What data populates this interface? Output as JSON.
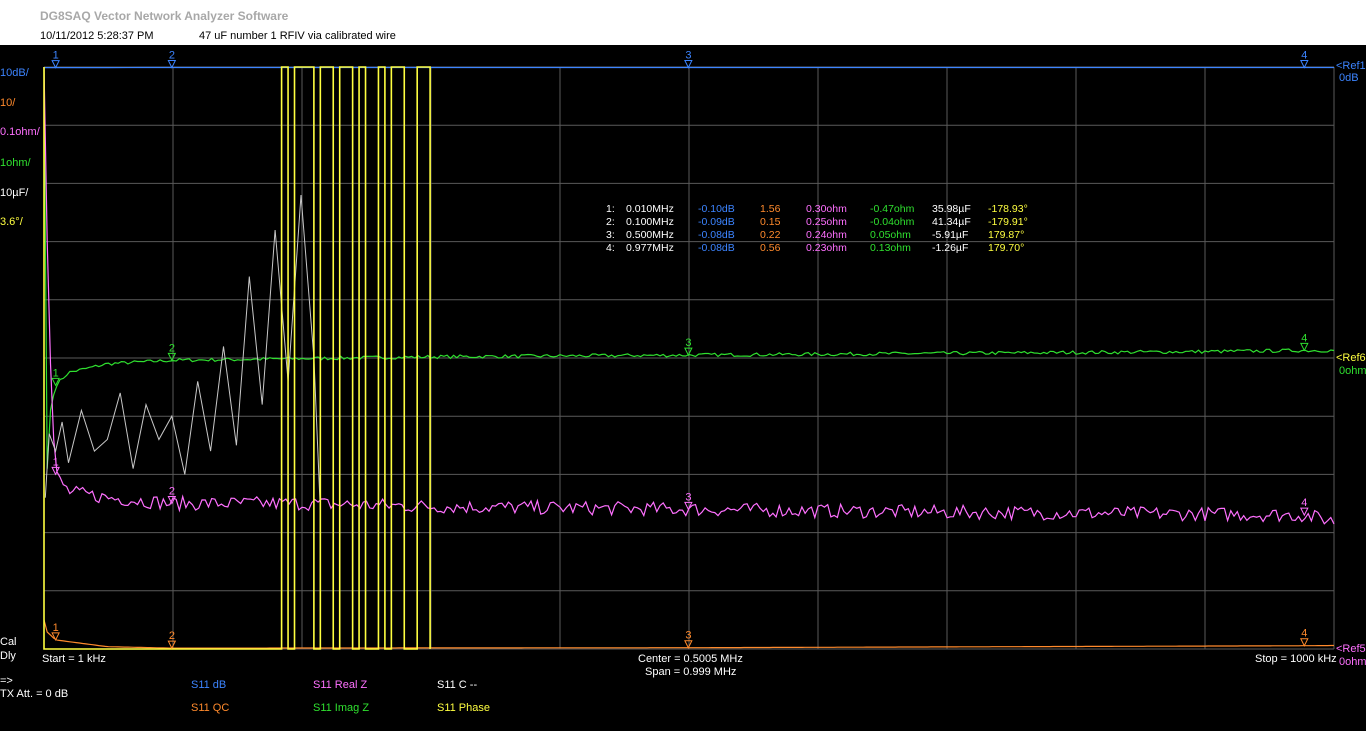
{
  "header": {
    "app_title": "DG8SAQ Vector Network Analyzer Software",
    "datetime": "10/11/2012   5:28:37 PM",
    "comment": "47  uF number 1 RFIV via calibrated wire"
  },
  "scale_labels": [
    {
      "text": "10dB/",
      "color": "#3c84ff"
    },
    {
      "text": "10/",
      "color": "#ff8a2c"
    },
    {
      "text": "0.1ohm/",
      "color": "#ff70ff"
    },
    {
      "text": "1ohm/",
      "color": "#2fe02f"
    },
    {
      "text": "10µF/",
      "color": "#ffffff"
    },
    {
      "text": "3.6°/",
      "color": "#ffff40"
    }
  ],
  "ref_labels": {
    "ref1": "<Ref1",
    "ref1_value": "0dB",
    "ref_mid": "<Ref6",
    "ref_mid_value": "0ohm",
    "ref_bottom": "<Ref5",
    "ref_bottom_value": "0ohm"
  },
  "footer": {
    "cal": "Cal",
    "dly": "Dly",
    "start": "Start = 1 kHz",
    "center": "Center = 0.5005 MHz",
    "span": "Span = 0.999 MHz",
    "stop": "Stop = 1000 kHz",
    "arrow": "=>",
    "tx_att": "TX Att.  = 0 dB"
  },
  "legend": [
    {
      "text": "S11  dB",
      "color": "#3c84ff"
    },
    {
      "text": "S11  QC",
      "color": "#ff8a2c"
    },
    {
      "text": "S11  Real Z",
      "color": "#ff70ff"
    },
    {
      "text": "S11  Imag Z",
      "color": "#2fe02f"
    },
    {
      "text": "S11  C --",
      "color": "#ffffff"
    },
    {
      "text": "S11  Phase",
      "color": "#ffff40"
    }
  ],
  "markers": [
    {
      "id": "1:",
      "freq": "0.010MHz",
      "db": "-0.10dB",
      "qc": "1.56",
      "realz": "0.30ohm",
      "imagz": "-0.47ohm",
      "cap": "35.98µF",
      "phase": "-178.93°"
    },
    {
      "id": "2:",
      "freq": "0.100MHz",
      "db": "-0.09dB",
      "qc": "0.15",
      "realz": "0.25ohm",
      "imagz": "-0.04ohm",
      "cap": "41.34µF",
      "phase": "-179.91°"
    },
    {
      "id": "3:",
      "freq": "0.500MHz",
      "db": "-0.08dB",
      "qc": "0.22",
      "realz": "0.24ohm",
      "imagz": "0.05ohm",
      "cap": "-5.91µF",
      "phase": "179.87°"
    },
    {
      "id": "4:",
      "freq": "0.977MHz",
      "db": "-0.08dB",
      "qc": "0.56",
      "realz": "0.23ohm",
      "imagz": "0.13ohm",
      "cap": "-1.26µF",
      "phase": "179.70°"
    }
  ],
  "chart_data": {
    "type": "line",
    "x_unit": "MHz",
    "xlim": [
      0.001,
      1.0
    ],
    "grid": true,
    "grid_divisions": {
      "x": 10,
      "y": 10
    },
    "marker_freqs_mhz": [
      0.01,
      0.1,
      0.5,
      0.977
    ],
    "marker_labels": [
      "1",
      "2",
      "3",
      "4"
    ],
    "series": [
      {
        "name": "S11  dB",
        "color": "#3c84ff",
        "scale_per_div": 10,
        "unit": "dB",
        "ref_div": 10,
        "ref_value": 0,
        "points": [
          [
            0.001,
            -0.1
          ],
          [
            0.01,
            -0.1
          ],
          [
            0.1,
            -0.09
          ],
          [
            0.5,
            -0.08
          ],
          [
            0.977,
            -0.08
          ],
          [
            1.0,
            -0.08
          ]
        ]
      },
      {
        "name": "S11  Imag Z",
        "color": "#2fe02f",
        "scale_per_div": 1,
        "unit": "ohm",
        "ref_div": 5,
        "ref_value": 0,
        "points": [
          [
            0.001,
            10
          ],
          [
            0.003,
            -2.2
          ],
          [
            0.005,
            -1.0
          ],
          [
            0.01,
            -0.47
          ],
          [
            0.02,
            -0.25
          ],
          [
            0.05,
            -0.1
          ],
          [
            0.1,
            -0.04
          ],
          [
            0.2,
            -0.01
          ],
          [
            0.3,
            0.02
          ],
          [
            0.5,
            0.05
          ],
          [
            0.7,
            0.08
          ],
          [
            0.9,
            0.11
          ],
          [
            0.977,
            0.13
          ],
          [
            1.0,
            0.13
          ]
        ]
      },
      {
        "name": "S11  Real Z",
        "color": "#ff70ff",
        "scale_per_div": 0.1,
        "unit": "ohm",
        "ref_div": 0,
        "ref_value": 0,
        "points": [
          [
            0.001,
            1.2
          ],
          [
            0.004,
            0.6
          ],
          [
            0.008,
            0.38
          ],
          [
            0.01,
            0.3
          ],
          [
            0.02,
            0.27
          ],
          [
            0.05,
            0.26
          ],
          [
            0.1,
            0.25
          ],
          [
            0.2,
            0.25
          ],
          [
            0.3,
            0.245
          ],
          [
            0.5,
            0.24
          ],
          [
            0.7,
            0.235
          ],
          [
            0.9,
            0.232
          ],
          [
            0.977,
            0.23
          ],
          [
            1.0,
            0.22
          ]
        ]
      },
      {
        "name": "S11  QC",
        "color": "#ff8a2c",
        "scale_per_div": 10,
        "unit": "",
        "ref_div": 0,
        "ref_value": 0,
        "points": [
          [
            0.001,
            5
          ],
          [
            0.003,
            3
          ],
          [
            0.01,
            1.56
          ],
          [
            0.05,
            0.4
          ],
          [
            0.1,
            0.15
          ],
          [
            0.5,
            0.22
          ],
          [
            0.977,
            0.56
          ],
          [
            1.0,
            0.6
          ]
        ]
      },
      {
        "name": "S11  C --",
        "color": "#ffffff",
        "scale_per_div": 10,
        "unit": "µF",
        "ref_div": 5,
        "ref_value": 0,
        "points": [
          [
            0.002,
            -24
          ],
          [
            0.005,
            -13
          ],
          [
            0.01,
            -16
          ],
          [
            0.015,
            -11
          ],
          [
            0.02,
            -18
          ],
          [
            0.03,
            -9
          ],
          [
            0.04,
            -16
          ],
          [
            0.05,
            -14
          ],
          [
            0.06,
            -6
          ],
          [
            0.07,
            -19
          ],
          [
            0.08,
            -8
          ],
          [
            0.09,
            -14
          ],
          [
            0.1,
            -10
          ],
          [
            0.11,
            -20
          ],
          [
            0.12,
            -4
          ],
          [
            0.13,
            -16
          ],
          [
            0.14,
            2
          ],
          [
            0.15,
            -15
          ],
          [
            0.16,
            14
          ],
          [
            0.17,
            -8
          ],
          [
            0.18,
            22
          ],
          [
            0.19,
            -4
          ],
          [
            0.2,
            28
          ],
          [
            0.21,
            0
          ],
          [
            0.215,
            -26
          ]
        ]
      },
      {
        "name": "S11  Phase",
        "color": "#ffff40",
        "scale_per_div": 3.6,
        "unit": "°",
        "ref_div": 5,
        "ref_value": 0,
        "points": [
          [
            0.001,
            -179
          ],
          [
            0.01,
            -178.93
          ],
          [
            0.1,
            -179.91
          ],
          [
            0.5,
            179.87
          ],
          [
            0.977,
            179.7
          ]
        ]
      }
    ]
  }
}
